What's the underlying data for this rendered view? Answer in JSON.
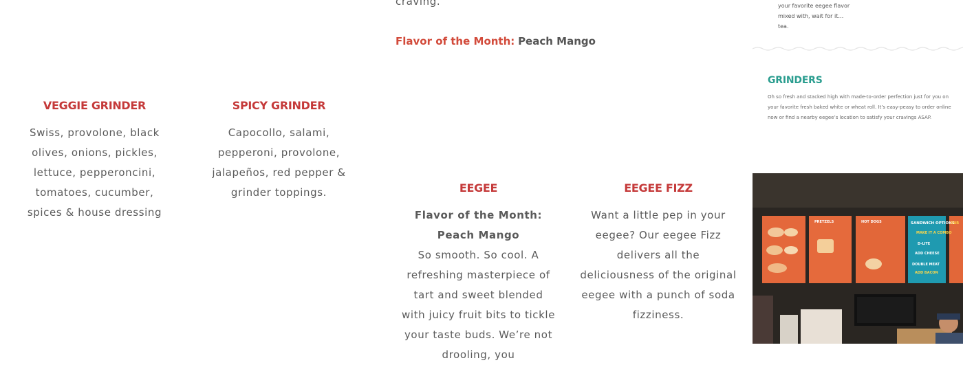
{
  "intro": {
    "partial_line": "craving.",
    "flavor_label": "Flavor of the Month:",
    "flavor_value": "Peach Mango"
  },
  "menu_items": [
    {
      "title": "VEGGIE GRINDER",
      "description": "Swiss, provolone, black olives, onions, pickles, lettuce, pepperoncini, tomatoes, cucumber, spices & house dressing"
    },
    {
      "title": "SPICY GRINDER",
      "description": "Capocollo, salami, pepperoni, provolone, jalapeños, red pepper & grinder toppings."
    },
    {
      "title": "EEGEE",
      "highlight": "Flavor of the Month: Peach Mango",
      "description": "So smooth. So cool. A refreshing masterpiece of tart and sweet blended with juicy fruit bits to tickle your taste buds. We’re not drooling, you"
    },
    {
      "title": "EEGEE FIZZ",
      "description": "Want a little pep in your eegee? Our eegee Fizz delivers all the deliciousness of the original eegee with a punch of soda fizziness."
    }
  ],
  "sidebar": {
    "tea_note": "your favorite eegee flavor mixed with, wait for it… tea.",
    "grinders": {
      "title": "GRINDERS",
      "description": "Oh so fresh and stacked high with made-to-order perfection just for you on your favorite fresh baked white or wheat roll. It’s easy-peasy to order online now or find a nearby eegee’s location to satisfy your cravings ASAP."
    },
    "photo_signs": {
      "sign1": "PRETZELS",
      "sign2": "HOT DOGS",
      "sign3": "SANDWICH OPTIONS",
      "sign3_sub": "MAKE IT A COMBO",
      "sign3_items": [
        "D-LITE",
        "ADD CHEESE",
        "DOUBLE MEAT",
        "ADD BACON"
      ],
      "sign4": "OUR"
    }
  },
  "colors": {
    "accent_red": "#c53a3a",
    "accent_teal": "#2a9d8f",
    "text_gray": "#5a5a5a"
  }
}
